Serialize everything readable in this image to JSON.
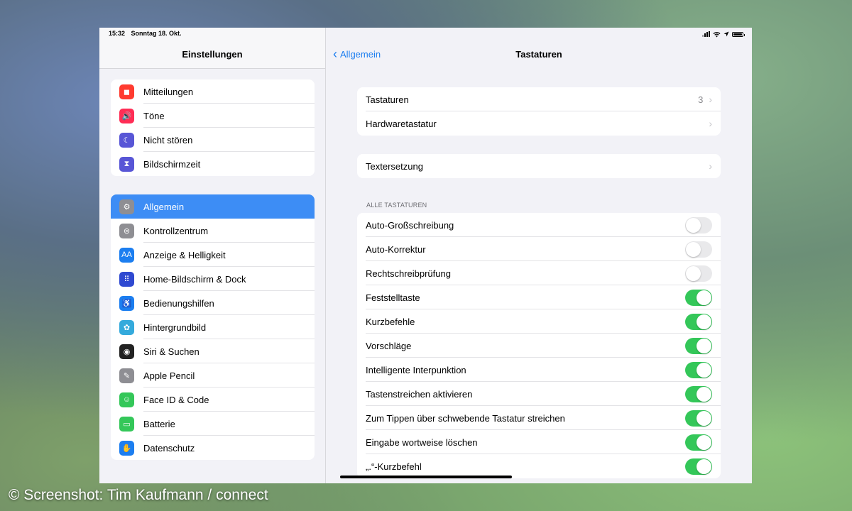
{
  "status": {
    "time": "15:32",
    "date": "Sonntag 18. Okt."
  },
  "sidebar": {
    "title": "Einstellungen",
    "group1": [
      {
        "label": "Mitteilungen",
        "icon": "notifications-icon",
        "color": "#ff3b30",
        "glyph": "◼"
      },
      {
        "label": "Töne",
        "icon": "sound-icon",
        "color": "#ff2d55",
        "glyph": "🔊"
      },
      {
        "label": "Nicht stören",
        "icon": "moon-icon",
        "color": "#5856d6",
        "glyph": "☾"
      },
      {
        "label": "Bildschirmzeit",
        "icon": "hourglass-icon",
        "color": "#5856d6",
        "glyph": "⧗"
      }
    ],
    "group2": [
      {
        "label": "Allgemein",
        "icon": "gear-icon",
        "color": "#8e8e93",
        "glyph": "⚙",
        "active": true
      },
      {
        "label": "Kontrollzentrum",
        "icon": "toggles-icon",
        "color": "#8e8e93",
        "glyph": "⊜"
      },
      {
        "label": "Anzeige & Helligkeit",
        "icon": "text-size-icon",
        "color": "#1c7ef0",
        "glyph": "AA"
      },
      {
        "label": "Home-Bildschirm & Dock",
        "icon": "home-grid-icon",
        "color": "#2f49d1",
        "glyph": "⠿"
      },
      {
        "label": "Bedienungshilfen",
        "icon": "accessibility-icon",
        "color": "#1c7ef0",
        "glyph": "♿"
      },
      {
        "label": "Hintergrundbild",
        "icon": "wallpaper-flower-icon",
        "color": "#34aadc",
        "glyph": "✿"
      },
      {
        "label": "Siri & Suchen",
        "icon": "siri-icon",
        "color": "#222222",
        "glyph": "◉"
      },
      {
        "label": "Apple Pencil",
        "icon": "pencil-icon",
        "color": "#8e8e93",
        "glyph": "✎"
      },
      {
        "label": "Face ID & Code",
        "icon": "face-id-icon",
        "color": "#34c759",
        "glyph": "☺"
      },
      {
        "label": "Batterie",
        "icon": "battery-icon",
        "color": "#34c759",
        "glyph": "▭"
      },
      {
        "label": "Datenschutz",
        "icon": "hand-icon",
        "color": "#1c7ef0",
        "glyph": "✋"
      }
    ]
  },
  "main": {
    "back_label": "Allgemein",
    "title": "Tastaturen",
    "group1": [
      {
        "label": "Tastaturen",
        "value": "3"
      },
      {
        "label": "Hardwaretastatur",
        "value": ""
      }
    ],
    "group2": [
      {
        "label": "Textersetzung",
        "value": ""
      }
    ],
    "section_header": "ALLE TASTATUREN",
    "toggles": [
      {
        "label": "Auto-Großschreibung",
        "on": false
      },
      {
        "label": "Auto-Korrektur",
        "on": false
      },
      {
        "label": "Rechtschreibprüfung",
        "on": false
      },
      {
        "label": "Feststelltaste",
        "on": true
      },
      {
        "label": "Kurzbefehle",
        "on": true
      },
      {
        "label": "Vorschläge",
        "on": true
      },
      {
        "label": "Intelligente Interpunktion",
        "on": true
      },
      {
        "label": "Tastenstreichen aktivieren",
        "on": true
      },
      {
        "label": "Zum Tippen über schwebende Tastatur streichen",
        "on": true
      },
      {
        "label": "Eingabe wortweise löschen",
        "on": true
      },
      {
        "label": "„.“-Kurzbefehl",
        "on": true
      }
    ]
  },
  "credit": "© Screenshot: Tim Kaufmann / connect"
}
